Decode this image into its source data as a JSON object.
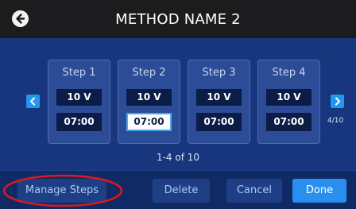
{
  "header": {
    "title": "METHOD NAME 2",
    "back_icon": "arrow-left-circle-icon"
  },
  "steps": [
    {
      "label": "Step 1",
      "voltage": "10 V",
      "time": "07:00",
      "selected": false
    },
    {
      "label": "Step 2",
      "voltage": "10 V",
      "time": "07:00",
      "selected": true
    },
    {
      "label": "Step 3",
      "voltage": "10 V",
      "time": "07:00",
      "selected": false
    },
    {
      "label": "Step 4",
      "voltage": "10 V",
      "time": "07:00",
      "selected": false
    }
  ],
  "pager": {
    "range_text": "1-4 of 10",
    "page_counter": "4/10",
    "prev_icon": "chevron-left-icon",
    "next_icon": "chevron-right-icon"
  },
  "footer": {
    "manage_label": "Manage Steps",
    "delete_label": "Delete",
    "cancel_label": "Cancel",
    "done_label": "Done"
  },
  "colors": {
    "panel": "#17367d",
    "titlebar": "#1c1c1e",
    "accent": "#2196f3",
    "done": "#2b8ff0",
    "annotation": "#e0181c"
  }
}
